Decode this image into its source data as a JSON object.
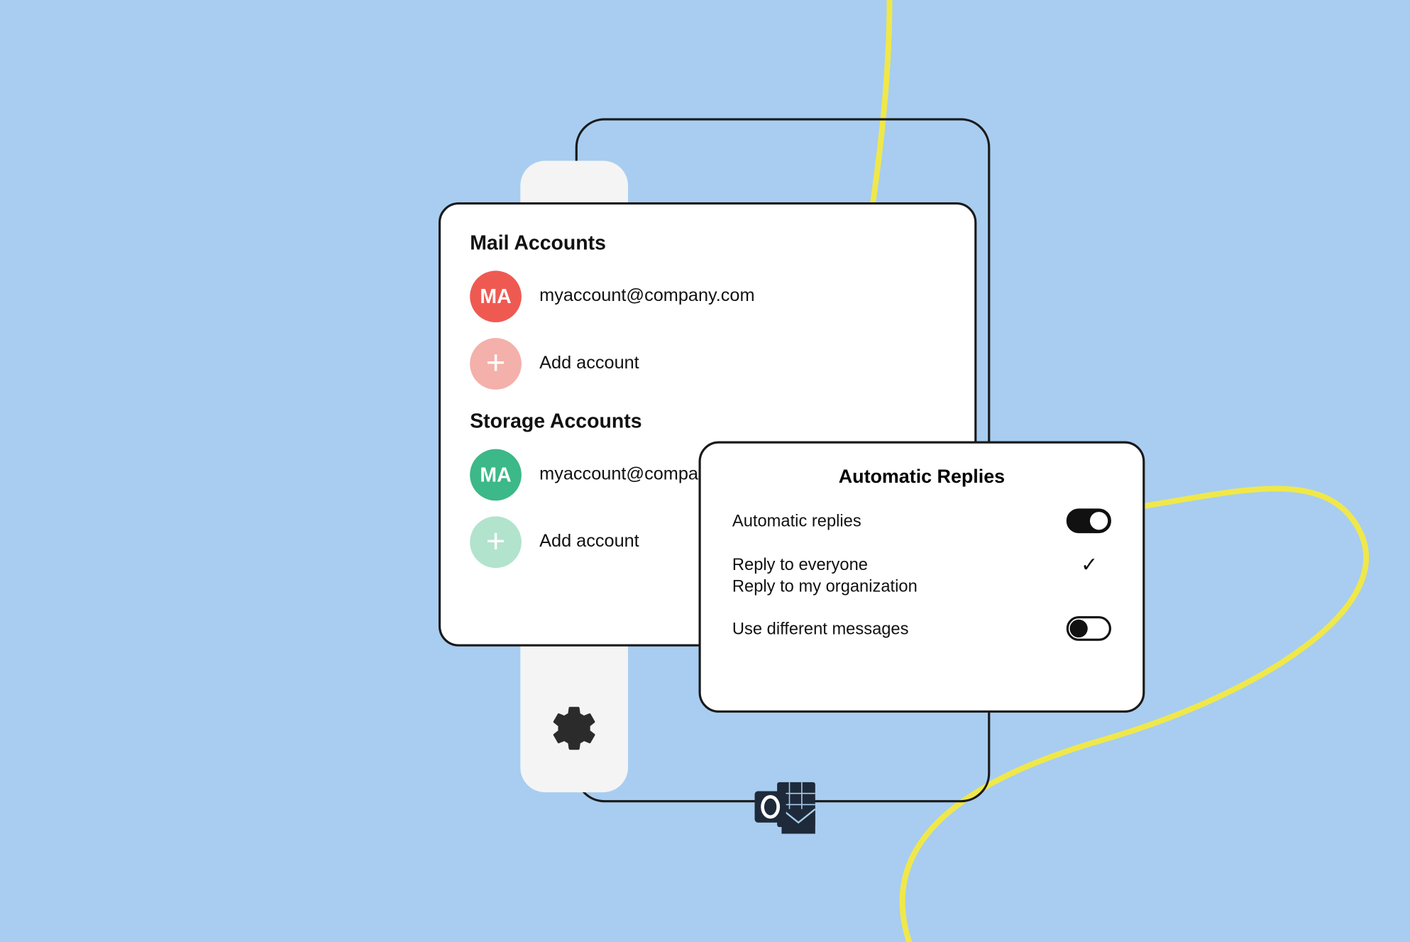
{
  "accounts": {
    "mail_title": "Mail Accounts",
    "storage_title": "Storage Accounts",
    "mail": {
      "initials": "MA",
      "email": "myaccount@company.com",
      "add_label": "Add account"
    },
    "storage": {
      "initials": "MA",
      "email": "myaccount@company.com",
      "add_label": "Add account"
    }
  },
  "replies": {
    "title": "Automatic Replies",
    "auto_label": "Automatic replies",
    "reply_everyone": "Reply to everyone",
    "reply_org": "Reply to my organization",
    "diff_msgs": "Use different messages"
  },
  "colors": {
    "bg": "#a8cdf0",
    "red": "#ee5a52",
    "red_soft": "#f4b0aa",
    "green": "#3db888",
    "green_soft": "#b2e3cd",
    "yellow": "#f0e84a"
  }
}
